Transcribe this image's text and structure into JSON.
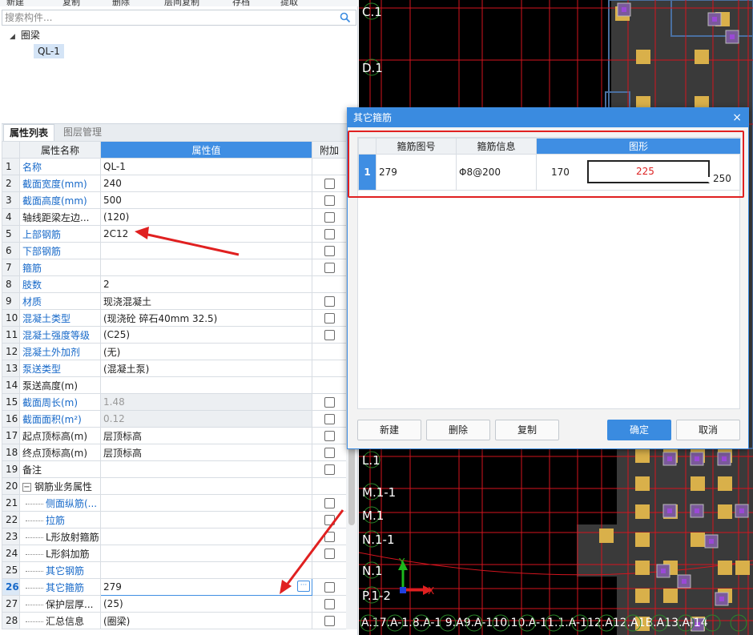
{
  "toolbar": {
    "new": "新建",
    "copy": "复制",
    "delete": "删除",
    "layer_copy": "层间复制",
    "save": "存档",
    "extract": "提取"
  },
  "search": {
    "placeholder": "搜索构件..."
  },
  "tree": {
    "root": "圈梁",
    "child": "QL-1"
  },
  "tabs": {
    "props": "属性列表",
    "layers": "图层管理"
  },
  "grid": {
    "headers": {
      "name": "属性名称",
      "value": "属性值",
      "extra": "附加"
    },
    "rows": [
      {
        "n": "1",
        "name": "名称",
        "value": "QL-1",
        "blue": true,
        "chk": false
      },
      {
        "n": "2",
        "name": "截面宽度(mm)",
        "value": "240",
        "blue": true,
        "chk": true
      },
      {
        "n": "3",
        "name": "截面高度(mm)",
        "value": "500",
        "blue": true,
        "chk": true
      },
      {
        "n": "4",
        "name": "轴线距梁左边...",
        "value": "(120)",
        "blue": false,
        "chk": true
      },
      {
        "n": "5",
        "name": "上部钢筋",
        "value": "2C12",
        "blue": true,
        "chk": true
      },
      {
        "n": "6",
        "name": "下部钢筋",
        "value": "",
        "blue": true,
        "chk": true
      },
      {
        "n": "7",
        "name": "箍筋",
        "value": "",
        "blue": true,
        "chk": true
      },
      {
        "n": "8",
        "name": "肢数",
        "value": "2",
        "blue": true,
        "chk": false
      },
      {
        "n": "9",
        "name": "材质",
        "value": "现浇混凝土",
        "blue": true,
        "chk": true
      },
      {
        "n": "10",
        "name": "混凝土类型",
        "value": "(现浇砼 碎石40mm 32.5)",
        "blue": true,
        "chk": true
      },
      {
        "n": "11",
        "name": "混凝土强度等级",
        "value": "(C25)",
        "blue": true,
        "chk": true
      },
      {
        "n": "12",
        "name": "混凝土外加剂",
        "value": "(无)",
        "blue": true,
        "chk": false
      },
      {
        "n": "13",
        "name": "泵送类型",
        "value": "(混凝土泵)",
        "blue": true,
        "chk": false
      },
      {
        "n": "14",
        "name": "泵送高度(m)",
        "value": "",
        "blue": false,
        "chk": false
      },
      {
        "n": "15",
        "name": "截面周长(m)",
        "value": "1.48",
        "blue": true,
        "chk": true,
        "gray": true
      },
      {
        "n": "16",
        "name": "截面面积(m²)",
        "value": "0.12",
        "blue": true,
        "chk": true,
        "gray": true
      },
      {
        "n": "17",
        "name": "起点顶标高(m)",
        "value": "层顶标高",
        "blue": false,
        "chk": true
      },
      {
        "n": "18",
        "name": "终点顶标高(m)",
        "value": "层顶标高",
        "blue": false,
        "chk": true
      },
      {
        "n": "19",
        "name": "备注",
        "value": "",
        "blue": false,
        "chk": true
      },
      {
        "n": "20",
        "name": "钢筋业务属性",
        "value": "",
        "blue": false,
        "chk": false,
        "group": true
      },
      {
        "n": "21",
        "name": "侧面纵筋(...",
        "value": "",
        "blue": true,
        "chk": true,
        "child": true
      },
      {
        "n": "22",
        "name": "拉筋",
        "value": "",
        "blue": true,
        "chk": true,
        "child": true
      },
      {
        "n": "23",
        "name": "L形放射箍筋",
        "value": "",
        "blue": false,
        "chk": true,
        "child": true
      },
      {
        "n": "24",
        "name": "L形斜加筋",
        "value": "",
        "blue": false,
        "chk": true,
        "child": true
      },
      {
        "n": "25",
        "name": "其它钢筋",
        "value": "",
        "blue": true,
        "chk": false,
        "child": true
      },
      {
        "n": "26",
        "name": "其它箍筋",
        "value": "279",
        "blue": true,
        "chk": true,
        "child": true,
        "sel": true
      },
      {
        "n": "27",
        "name": "保护层厚...",
        "value": "(25)",
        "blue": false,
        "chk": true,
        "child": true
      },
      {
        "n": "28",
        "name": "汇总信息",
        "value": "(圈梁)",
        "blue": false,
        "chk": true,
        "child": true
      }
    ]
  },
  "cad": {
    "axis_labels": [
      "C.1",
      "D.1",
      "L.1",
      "M.1-1",
      "M.1",
      "N.1-1",
      "N.1",
      "P.1-2"
    ],
    "bottom_labels": "A.17.A-1.8.A-1  9.A9.A-110.10.A-11.1.A-112.A12.A1B.A13.A-14",
    "x_label": "X",
    "y_label": "Y",
    "colors": {
      "grid": "#d4141e",
      "column": "#d9b04a",
      "column_core": "#9a49d6",
      "slab": "#3a3a3a",
      "axis_circle": "#2a8a2a"
    }
  },
  "dialog": {
    "title": "其它箍筋",
    "close": "×",
    "headers": {
      "shape_no": "箍筋图号",
      "info": "箍筋信息",
      "shape": "图形"
    },
    "row": {
      "n": "1",
      "shape_no": "279",
      "info": "Ⲍ8@200",
      "left": "170",
      "mid": "225",
      "right": "250"
    },
    "buttons": {
      "new": "新建",
      "delete": "删除",
      "copy": "复制",
      "ok": "确定",
      "cancel": "取消"
    }
  }
}
